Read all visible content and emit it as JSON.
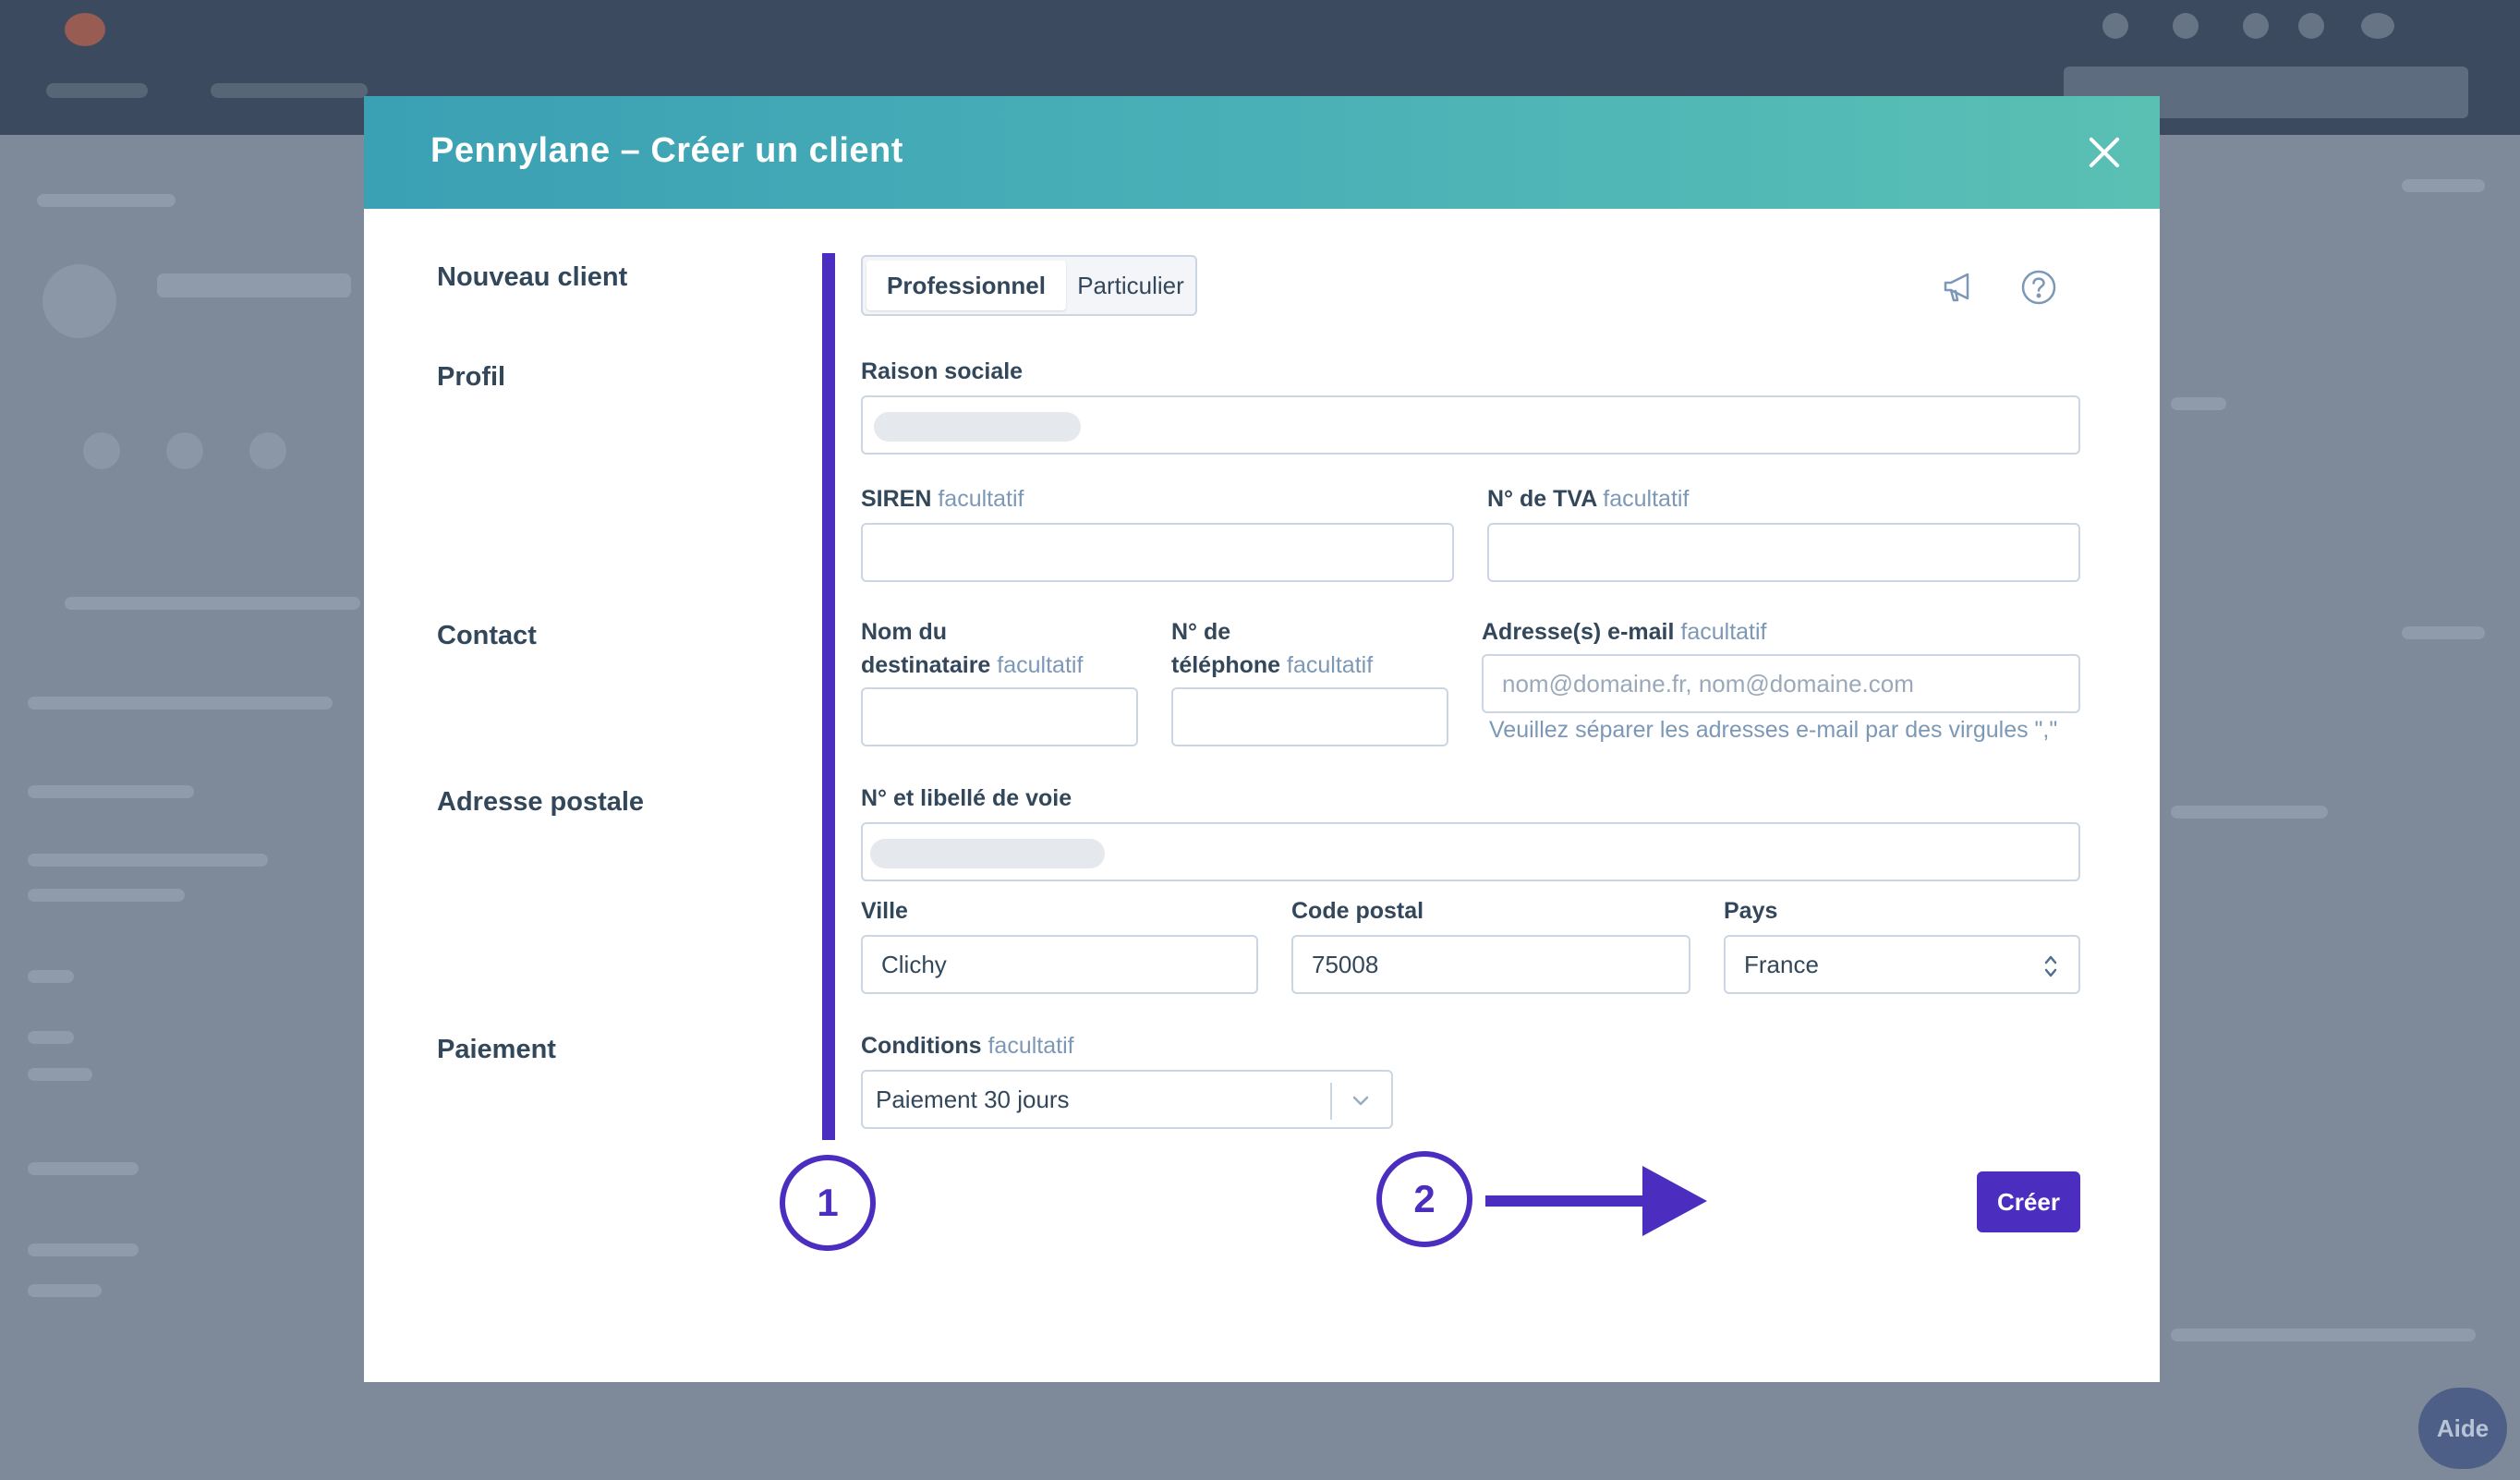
{
  "background": {
    "help_button": "Aide"
  },
  "modal": {
    "title": "Pennylane – Créer un client",
    "sections": {
      "new_client": "Nouveau client",
      "profile": "Profil",
      "contact": "Contact",
      "address": "Adresse postale",
      "payment": "Paiement"
    },
    "client_type": {
      "professional": "Professionnel",
      "individual": "Particulier",
      "selected": "Professionnel"
    },
    "icons": {
      "announce": "megaphone-icon",
      "help": "help-circle-icon",
      "close": "close-icon"
    },
    "fields": {
      "company_name": {
        "label": "Raison sociale",
        "value": ""
      },
      "siren": {
        "label": "SIREN",
        "optional": "facultatif",
        "value": ""
      },
      "vat": {
        "label": "N° de TVA",
        "optional": "facultatif",
        "value": ""
      },
      "recipient_name": {
        "label_line1": "Nom du",
        "label_line2": "destinataire",
        "optional": "facultatif",
        "value": ""
      },
      "phone": {
        "label_line1": "N° de",
        "label_line2": "téléphone",
        "optional": "facultatif",
        "value": ""
      },
      "emails": {
        "label": "Adresse(s) e-mail",
        "optional": "facultatif",
        "placeholder": "nom@domaine.fr, nom@domaine.com",
        "hint": "Veuillez séparer les adresses e-mail par des virgules \",\""
      },
      "street": {
        "label": "N° et libellé de voie",
        "value": ""
      },
      "city": {
        "label": "Ville",
        "value": "Clichy"
      },
      "postal_code": {
        "label": "Code postal",
        "value": "75008"
      },
      "country": {
        "label": "Pays",
        "value": "France"
      },
      "terms": {
        "label": "Conditions",
        "optional": "facultatif",
        "value": "Paiement 30 jours"
      }
    },
    "submit_label": "Créer"
  },
  "annotations": {
    "step1": "1",
    "step2": "2"
  },
  "colors": {
    "accent": "#4b2ec0",
    "header_start": "#3aa0b4",
    "header_end": "#5ac0b4"
  }
}
